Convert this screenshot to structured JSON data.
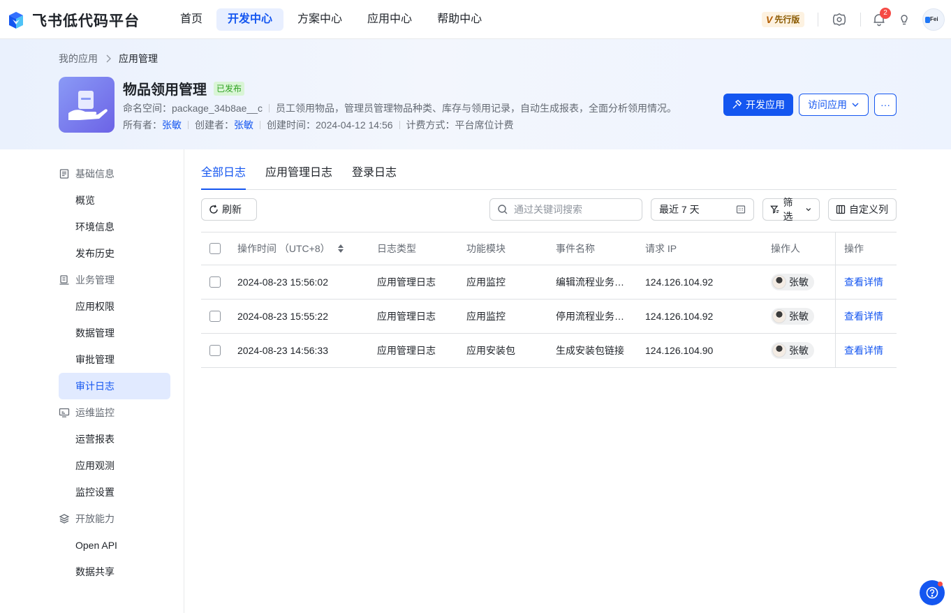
{
  "brand": {
    "name": "飞书低代码平台"
  },
  "nav": {
    "items": [
      {
        "label": "首页",
        "active": false
      },
      {
        "label": "开发中心",
        "active": true
      },
      {
        "label": "方案中心",
        "active": false
      },
      {
        "label": "应用中心",
        "active": false
      },
      {
        "label": "帮助中心",
        "active": false
      }
    ],
    "preview_badge": "先行版",
    "preview_mark": "V",
    "notification_count": "2",
    "avatar_text": "Fei"
  },
  "breadcrumb": {
    "parent": "我的应用",
    "current": "应用管理"
  },
  "app": {
    "title": "物品领用管理",
    "status": "已发布",
    "namespace_label": "命名空间：",
    "namespace": "package_34b8ae__c",
    "description": "员工领用物品，管理员管理物品种类、库存与领用记录，自动生成报表，全面分析领用情况。",
    "owner_label": "所有者：",
    "owner": "张敏",
    "creator_label": "创建者：",
    "creator": "张敏",
    "created_label": "创建时间：",
    "created": "2024-04-12 14:56",
    "billing_label": "计费方式：",
    "billing": "平台席位计费"
  },
  "actions": {
    "develop": "开发应用",
    "visit": "访问应用",
    "more": "···"
  },
  "sidebar": {
    "groups": [
      {
        "label": "基础信息",
        "icon": "document-icon",
        "items": [
          "概览",
          "环境信息",
          "发布历史"
        ]
      },
      {
        "label": "业务管理",
        "icon": "business-icon",
        "items": [
          "应用权限",
          "数据管理",
          "审批管理",
          "审计日志"
        ]
      },
      {
        "label": "运维监控",
        "icon": "monitor-icon",
        "items": [
          "运营报表",
          "应用观测",
          "监控设置"
        ]
      },
      {
        "label": "开放能力",
        "icon": "layers-icon",
        "items": [
          "Open API",
          "数据共享"
        ]
      }
    ],
    "active_item": "审计日志"
  },
  "tabs": [
    {
      "label": "全部日志",
      "active": true
    },
    {
      "label": "应用管理日志",
      "active": false
    },
    {
      "label": "登录日志",
      "active": false
    }
  ],
  "toolbar": {
    "refresh": "刷新",
    "search_placeholder": "通过关键词搜索",
    "date_range": "最近 7 天",
    "filter": "筛选",
    "custom_columns": "自定义列"
  },
  "table": {
    "columns": [
      "操作时间 （UTC+8）",
      "日志类型",
      "功能模块",
      "事件名称",
      "请求 IP",
      "操作人",
      "操作"
    ],
    "rows": [
      {
        "time": "2024-08-23 15:56:02",
        "type": "应用管理日志",
        "module": "应用监控",
        "event": "编辑流程业务…",
        "ip": "124.126.104.92",
        "operator": "张敏",
        "action": "查看详情"
      },
      {
        "time": "2024-08-23 15:55:22",
        "type": "应用管理日志",
        "module": "应用监控",
        "event": "停用流程业务…",
        "ip": "124.126.104.92",
        "operator": "张敏",
        "action": "查看详情"
      },
      {
        "time": "2024-08-23 14:56:33",
        "type": "应用管理日志",
        "module": "应用安装包",
        "event": "生成安装包链接",
        "ip": "124.126.104.90",
        "operator": "张敏",
        "action": "查看详情"
      }
    ]
  },
  "colors": {
    "accent": "#1456f0",
    "published": "#2ea121",
    "badge_red": "#f54a45"
  }
}
